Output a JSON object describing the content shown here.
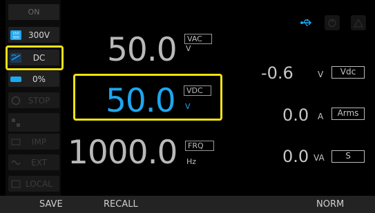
{
  "sidebar": {
    "on_label": "ON",
    "range_label": "300V",
    "mode_label": "DC",
    "percent_label": "0%",
    "stop_label": "STOP",
    "imp_label": "IMP",
    "ext_label": "EXT",
    "local_label": "LOCAL"
  },
  "settings": {
    "vac": {
      "value": "50.0",
      "tag": "VAC",
      "unit": "V"
    },
    "vdc": {
      "value": "50.0",
      "tag": "VDC",
      "unit": "V"
    },
    "frq": {
      "value": "1000.0",
      "tag": "FRQ",
      "unit": "Hz"
    }
  },
  "measurements": [
    {
      "value": "-0.6",
      "unit": "V",
      "tag": "Vdc"
    },
    {
      "value": "0.0",
      "unit": "A",
      "tag": "Arms"
    },
    {
      "value": "0.0",
      "unit": "VA",
      "tag": "S"
    }
  ],
  "status_icons": [
    "usb-icon",
    "power-icon",
    "warning-icon"
  ],
  "softkeys": {
    "save": "SAVE",
    "recall": "RECALL",
    "norm": "NORM"
  },
  "colors": {
    "accent": "#1da7f0",
    "highlight": "#f4e312",
    "text": "#b9b9b9"
  }
}
